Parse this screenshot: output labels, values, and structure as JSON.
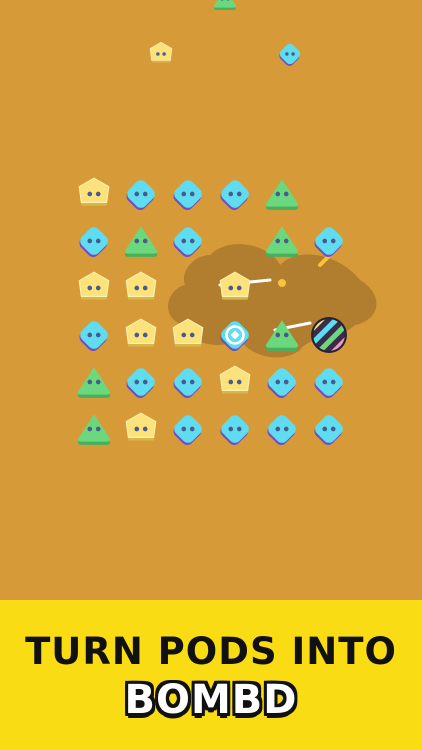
{
  "banner": {
    "line1": "TURN PODS INTO",
    "line2": "BOMBD"
  },
  "colors": {
    "background": "#d69a38",
    "banner": "#f9dc14",
    "yellow_pod": "#fce27a",
    "blue_pod": "#5fdcf0",
    "green_pod": "#6bd87e"
  },
  "board": {
    "rows": [
      [
        "yellow",
        "blue",
        "blue",
        "blue",
        "green",
        "empty"
      ],
      [
        "blue",
        "green",
        "blue",
        "empty",
        "green",
        "blue"
      ],
      [
        "yellow",
        "yellow",
        "empty",
        "yellow",
        "empty",
        "empty"
      ],
      [
        "blue",
        "yellow",
        "yellow",
        "target",
        "green",
        "striped-bomb"
      ],
      [
        "green",
        "blue",
        "blue",
        "yellow",
        "blue",
        "blue"
      ],
      [
        "green",
        "yellow",
        "blue",
        "blue",
        "blue",
        "blue"
      ]
    ]
  },
  "falling_pods": [
    "green",
    "yellow",
    "blue"
  ]
}
